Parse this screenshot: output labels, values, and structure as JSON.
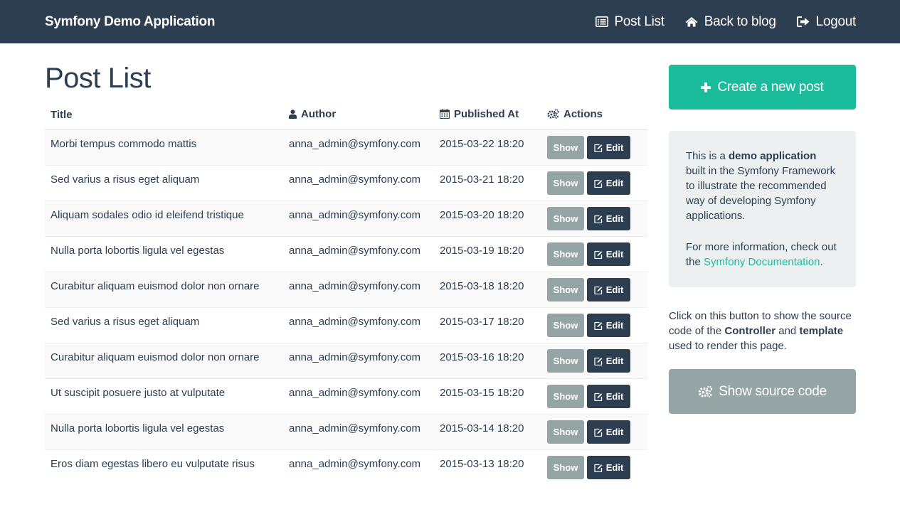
{
  "navbar": {
    "brand": "Symfony Demo Application",
    "links": [
      {
        "label": "Post List",
        "icon": "list-alt-icon"
      },
      {
        "label": "Back to blog",
        "icon": "home-icon"
      },
      {
        "label": "Logout",
        "icon": "sign-out-icon"
      }
    ]
  },
  "main": {
    "title": "Post List",
    "columns": {
      "title": "Title",
      "author": "Author",
      "published_at": "Published At",
      "actions": "Actions"
    },
    "show_label": "Show",
    "edit_label": "Edit",
    "posts": [
      {
        "title": "Morbi tempus commodo mattis",
        "author": "anna_admin@symfony.com",
        "published_at": "2015-03-22 18:20"
      },
      {
        "title": "Sed varius a risus eget aliquam",
        "author": "anna_admin@symfony.com",
        "published_at": "2015-03-21 18:20"
      },
      {
        "title": "Aliquam sodales odio id eleifend tristique",
        "author": "anna_admin@symfony.com",
        "published_at": "2015-03-20 18:20"
      },
      {
        "title": "Nulla porta lobortis ligula vel egestas",
        "author": "anna_admin@symfony.com",
        "published_at": "2015-03-19 18:20"
      },
      {
        "title": "Curabitur aliquam euismod dolor non ornare",
        "author": "anna_admin@symfony.com",
        "published_at": "2015-03-18 18:20"
      },
      {
        "title": "Sed varius a risus eget aliquam",
        "author": "anna_admin@symfony.com",
        "published_at": "2015-03-17 18:20"
      },
      {
        "title": "Curabitur aliquam euismod dolor non ornare",
        "author": "anna_admin@symfony.com",
        "published_at": "2015-03-16 18:20"
      },
      {
        "title": "Ut suscipit posuere justo at vulputate",
        "author": "anna_admin@symfony.com",
        "published_at": "2015-03-15 18:20"
      },
      {
        "title": "Nulla porta lobortis ligula vel egestas",
        "author": "anna_admin@symfony.com",
        "published_at": "2015-03-14 18:20"
      },
      {
        "title": "Eros diam egestas libero eu vulputate risus",
        "author": "anna_admin@symfony.com",
        "published_at": "2015-03-13 18:20"
      }
    ]
  },
  "sidebar": {
    "create_label": "Create a new post",
    "info": {
      "p1_prefix": "This is a ",
      "p1_bold": "demo application",
      "p1_suffix": " built in the Symfony Framework to illustrate the recommended way of developing Symfony applications.",
      "p2_prefix": "For more information, check out the ",
      "p2_link": "Symfony Documentation",
      "p2_suffix": "."
    },
    "help": {
      "t1": "Click on this button to show the source code of the ",
      "b1": "Controller",
      "t2": " and ",
      "b2": "template",
      "t3": " used to render this page."
    },
    "source_label": "Show source code"
  },
  "colors": {
    "navbar": "#2c3e50",
    "primary": "#2c3e50",
    "success": "#1abc9c",
    "default": "#95a5a6",
    "well": "#ecf0f1",
    "link": "#18bc9c"
  }
}
